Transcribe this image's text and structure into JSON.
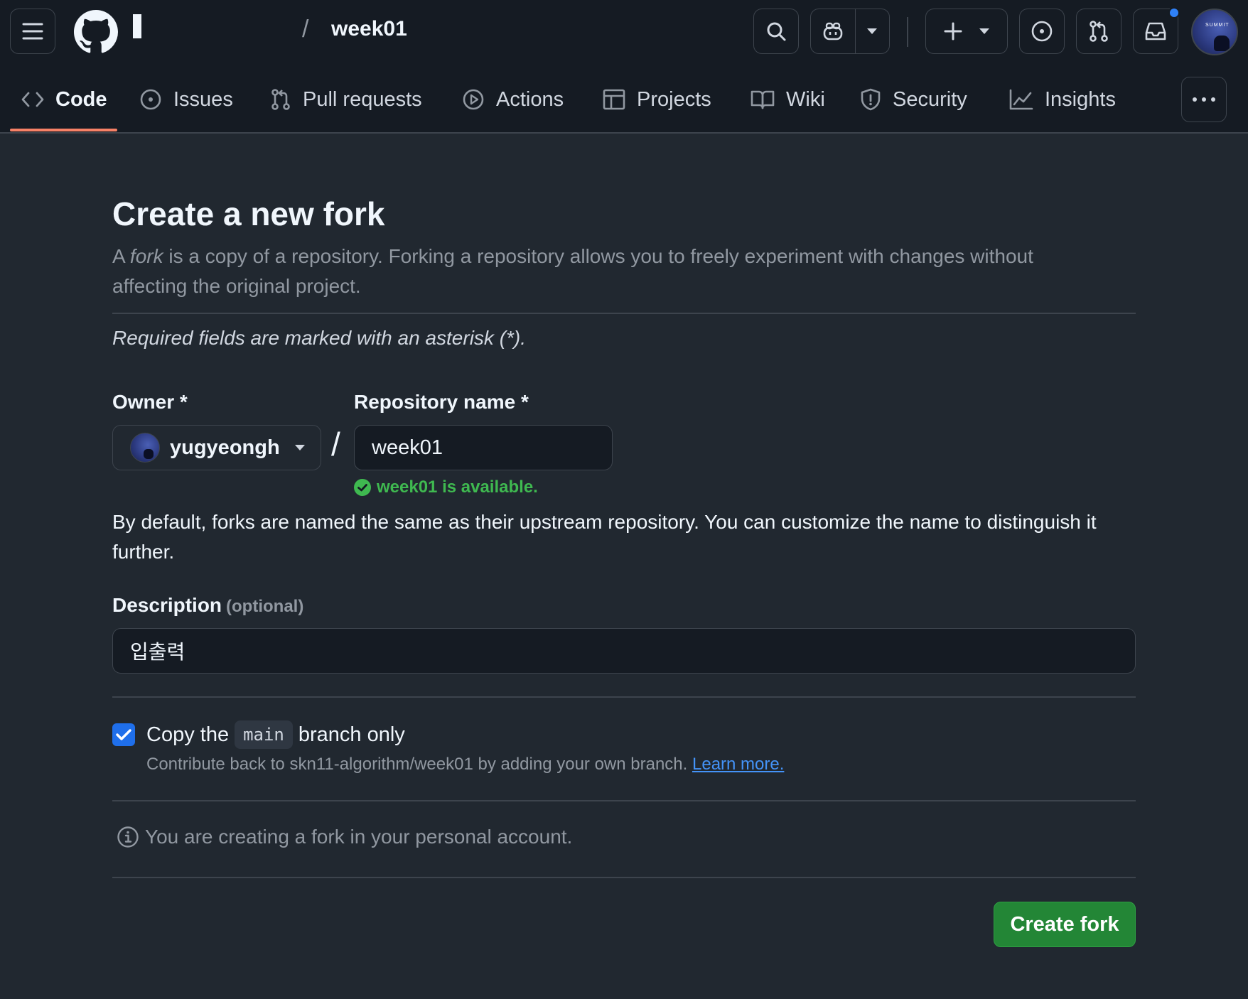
{
  "header": {
    "breadcrumb_separator": "/",
    "repo_name": "week01",
    "avatar_text": "SUMMIT",
    "icons": [
      "menu-icon",
      "github-logo",
      "search-icon",
      "copilot-icon",
      "plus-icon",
      "issue-icon",
      "pull-request-icon",
      "inbox-icon"
    ]
  },
  "tabs": [
    {
      "label": "Code",
      "icon": "code-icon",
      "active": true
    },
    {
      "label": "Issues",
      "icon": "issue-icon"
    },
    {
      "label": "Pull requests",
      "icon": "pull-request-icon"
    },
    {
      "label": "Actions",
      "icon": "play-icon"
    },
    {
      "label": "Projects",
      "icon": "table-icon"
    },
    {
      "label": "Wiki",
      "icon": "book-icon"
    },
    {
      "label": "Security",
      "icon": "shield-icon"
    },
    {
      "label": "Insights",
      "icon": "graph-icon"
    }
  ],
  "form": {
    "title": "Create a new fork",
    "subtitle_a": "A",
    "subtitle_fork": "fork",
    "subtitle_b": "is a copy of a repository. Forking a repository allows you to freely experiment with changes without affecting the original project.",
    "required_note": "Required fields are marked with an asterisk (*).",
    "owner_label": "Owner *",
    "owner_value": "yugyeongh",
    "slash": "/",
    "repo_label": "Repository name *",
    "repo_value": "week01",
    "availability": "week01 is available.",
    "default_note": "By default, forks are named the same as their upstream repository. You can customize the name to distinguish it further.",
    "description_label": "Description",
    "description_optional": "(optional)",
    "description_value": "입출력",
    "copy_prefix": "Copy the",
    "copy_branch": "main",
    "copy_suffix": "branch only",
    "copy_checked": true,
    "contrib_text": "Contribute back to skn11-algorithm/week01 by adding your own branch.",
    "learn_more": "Learn more.",
    "personal_note": "You are creating a fork in your personal account.",
    "submit_label": "Create fork"
  },
  "colors": {
    "background": "#212830",
    "header": "#151b23",
    "accent_green": "#238636",
    "available_green": "#3fb950",
    "link_blue": "#4493f8",
    "tab_underline": "#f78166"
  }
}
